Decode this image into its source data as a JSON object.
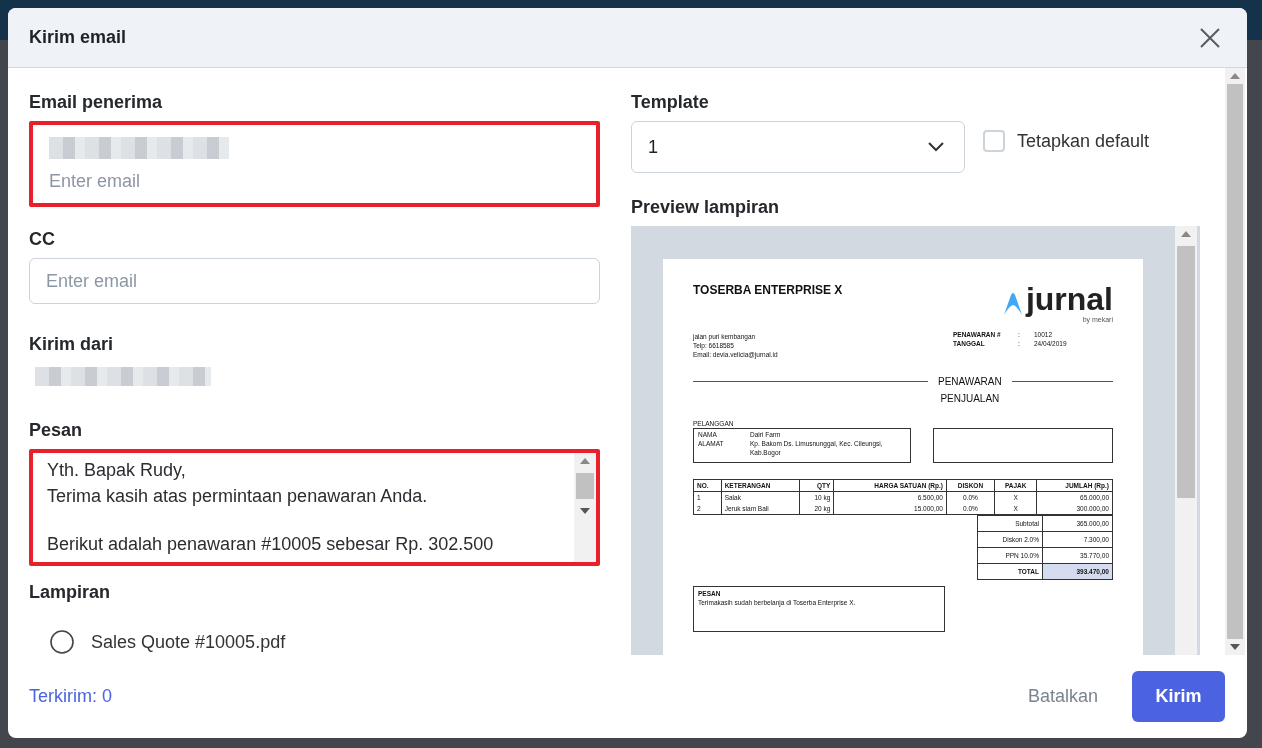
{
  "dialog": {
    "title": "Kirim email"
  },
  "recipient": {
    "label": "Email penerima",
    "placeholder": "Enter email",
    "highlighted": true
  },
  "cc": {
    "label": "CC",
    "placeholder": "Enter email",
    "highlighted": false
  },
  "sender": {
    "label": "Kirim dari"
  },
  "message": {
    "label": "Pesan",
    "highlighted": true,
    "paragraphs": [
      [
        "Yth. Bapak Rudy,",
        "Terima kasih atas permintaan penawaran Anda."
      ],
      [
        "Berikut adalah penawaran #10005 sebesar Rp. 302.500"
      ]
    ]
  },
  "attachments": {
    "label": "Lampiran",
    "items": [
      {
        "name": "Sales Quote #10005.pdf"
      }
    ]
  },
  "template": {
    "label": "Template",
    "value": "1"
  },
  "set_default": {
    "label": "Tetapkan default",
    "checked": false
  },
  "preview": {
    "label": "Preview lampiran",
    "document": {
      "company": "TOSERBA ENTERPRISE X",
      "logo": "jurnal",
      "logo_sub": "by mekari",
      "address": [
        "jalan puri kembangan",
        "Telp: 6618585",
        "Email: devia.velicia@jurnal.id"
      ],
      "meta": [
        {
          "label": "PENAWARAN #",
          "separator": ":",
          "value": "10012"
        },
        {
          "label": "TANGGAL",
          "separator": ":",
          "value": "24/04/2019"
        }
      ],
      "title": [
        "PENAWARAN",
        "PENJUALAN"
      ],
      "customer_heading": "PELANGGAN",
      "customer": [
        {
          "label": "NAMA",
          "value": "Dairi Farm"
        },
        {
          "label": "ALAMAT",
          "value": "Kp. Bakom Ds. Limusnunggal, Kec. Cileungsi, Kab.Bogor"
        }
      ],
      "columns": [
        "NO.",
        "KETERANGAN",
        "QTY",
        "HARGA SATUAN (Rp.)",
        "DISKON",
        "PAJAK",
        "JUMLAH (Rp.)"
      ],
      "rows": [
        [
          "1",
          "Salak",
          "10 kg",
          "6.500,00",
          "0.0%",
          "X",
          "65.000,00"
        ],
        [
          "2",
          "Jeruk siam Bali",
          "20 kg",
          "15.000,00",
          "0.0%",
          "X",
          "300.000,00"
        ]
      ],
      "totals": [
        {
          "label": "Subtotal",
          "value": "365.000,00",
          "highlighted": false
        },
        {
          "label": "Diskon 2.0%",
          "value": "7.300,00",
          "highlighted": false
        },
        {
          "label": "PPN 10.0%",
          "value": "35.770,00",
          "highlighted": false
        },
        {
          "label": "TOTAL",
          "value": "393.470,00",
          "highlighted": true
        }
      ],
      "message_heading": "PESAN",
      "message": "Terimakasih sudah berbelanja di Toserba Enterprise X."
    }
  },
  "footer": {
    "sent_count": "Terkirim: 0",
    "cancel": "Batalkan",
    "send": "Kirim"
  }
}
